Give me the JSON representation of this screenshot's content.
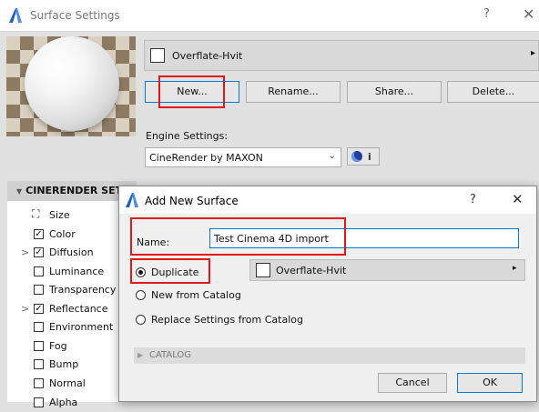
{
  "window": {
    "title": "Surface Settings",
    "help": "?",
    "close": "✕"
  },
  "surface": {
    "name": "Overflate-Hvit",
    "arrow": "▸",
    "buttons": {
      "new": "New...",
      "rename": "Rename...",
      "share": "Share...",
      "delete": "Delete..."
    }
  },
  "engine": {
    "label": "Engine Settings:",
    "value": "CineRender by MAXON",
    "arrow": "⌄",
    "info": "i"
  },
  "settings": {
    "header": "CINERENDER SETTINGS",
    "items": [
      {
        "label": "Size",
        "checkbox": false,
        "expander": "",
        "checked": false
      },
      {
        "label": "Color",
        "checkbox": true,
        "expander": "",
        "checked": true
      },
      {
        "label": "Diffusion",
        "checkbox": true,
        "expander": ">",
        "checked": true
      },
      {
        "label": "Luminance",
        "checkbox": true,
        "expander": "",
        "checked": false
      },
      {
        "label": "Transparency",
        "checkbox": true,
        "expander": "",
        "checked": false
      },
      {
        "label": "Reflectance",
        "checkbox": true,
        "expander": ">",
        "checked": true
      },
      {
        "label": "Environment",
        "checkbox": true,
        "expander": "",
        "checked": false
      },
      {
        "label": "Fog",
        "checkbox": true,
        "expander": "",
        "checked": false
      },
      {
        "label": "Bump",
        "checkbox": true,
        "expander": "",
        "checked": false
      },
      {
        "label": "Normal",
        "checkbox": true,
        "expander": "",
        "checked": false
      },
      {
        "label": "Alpha",
        "checkbox": true,
        "expander": "",
        "checked": false
      }
    ]
  },
  "dialog": {
    "title": "Add New Surface",
    "help": "?",
    "close": "✕",
    "name_label": "Name:",
    "name_value": "Test Cinema 4D import",
    "options": [
      {
        "label": "Duplicate",
        "selected": true
      },
      {
        "label": "New from Catalog",
        "selected": false
      },
      {
        "label": "Replace Settings from Catalog",
        "selected": false
      }
    ],
    "source_surface": "Overflate-Hvit",
    "source_arrow": "▸",
    "catalog": "CATALOG",
    "cancel": "Cancel",
    "ok": "OK"
  },
  "colors": {
    "accent": "#0078d7",
    "highlight": "#e01818",
    "app_icon": "#1f5fbf"
  }
}
